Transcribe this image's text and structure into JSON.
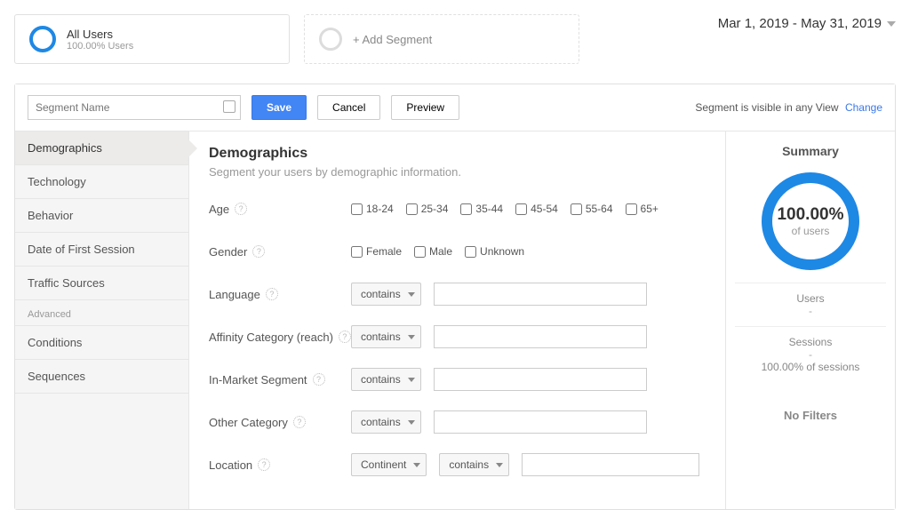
{
  "top": {
    "all_users": {
      "title": "All Users",
      "sub": "100.00% Users"
    },
    "add_segment": "+ Add Segment",
    "date_range": "Mar 1, 2019 - May 31, 2019"
  },
  "toolbar": {
    "segment_name_placeholder": "Segment Name",
    "save": "Save",
    "cancel": "Cancel",
    "preview": "Preview",
    "visibility": "Segment is visible in any View",
    "change": "Change"
  },
  "sidebar": {
    "items": [
      "Demographics",
      "Technology",
      "Behavior",
      "Date of First Session",
      "Traffic Sources"
    ],
    "advanced_label": "Advanced",
    "advanced_items": [
      "Conditions",
      "Sequences"
    ]
  },
  "content": {
    "heading": "Demographics",
    "subheading": "Segment your users by demographic information.",
    "age": {
      "label": "Age",
      "opts": [
        "18-24",
        "25-34",
        "35-44",
        "45-54",
        "55-64",
        "65+"
      ]
    },
    "gender": {
      "label": "Gender",
      "opts": [
        "Female",
        "Male",
        "Unknown"
      ]
    },
    "language": {
      "label": "Language",
      "op": "contains"
    },
    "affinity": {
      "label": "Affinity Category (reach)",
      "op": "contains"
    },
    "inmarket": {
      "label": "In-Market Segment",
      "op": "contains"
    },
    "other": {
      "label": "Other Category",
      "op": "contains"
    },
    "location": {
      "label": "Location",
      "scope": "Continent",
      "op": "contains"
    }
  },
  "summary": {
    "title": "Summary",
    "pct": "100.00%",
    "of": "of users",
    "users_label": "Users",
    "users_val": "-",
    "sessions_label": "Sessions",
    "sessions_val": "-",
    "sessions_pct": "100.00% of sessions",
    "no_filters": "No Filters"
  }
}
